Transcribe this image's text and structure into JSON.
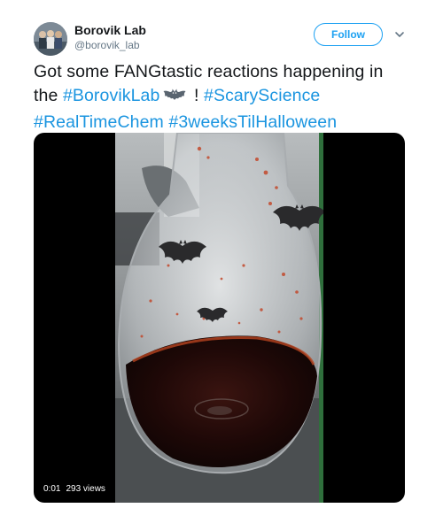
{
  "user": {
    "name": "Borovik Lab",
    "handle": "@borovik_lab"
  },
  "follow_button": {
    "label": "Follow"
  },
  "tweet": {
    "line1": "Got some FANGtastic reactions happening in",
    "line2_prefix": "the ",
    "hashtags": [
      "#BorovikLab",
      "#ScaryScience",
      "#RealTimeChem",
      "#3weeksTilHalloween"
    ],
    "line2_separator": " ! "
  },
  "video": {
    "time": "0:01",
    "views": "293 views"
  },
  "icons": {
    "caret": "chevron-down-icon",
    "emoji": "bat-emoji-icon"
  },
  "colors": {
    "link": "#1b95e0",
    "follow": "#1da1f2",
    "text": "#14171a",
    "secondary": "#657786"
  }
}
